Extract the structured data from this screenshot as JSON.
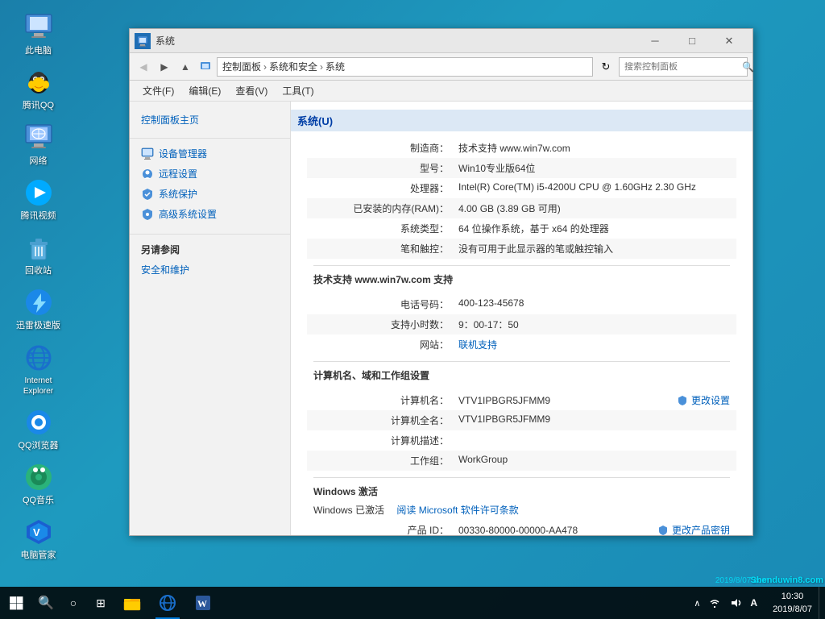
{
  "desktop": {
    "background": "#1a8ab5"
  },
  "desktop_icons": [
    {
      "id": "computer",
      "label": "此电脑",
      "icon": "💻"
    },
    {
      "id": "qq",
      "label": "腾讯QQ",
      "icon": "🐧"
    },
    {
      "id": "network",
      "label": "网络",
      "icon": "🌐"
    },
    {
      "id": "qqvideo",
      "label": "腾讯视频",
      "icon": "📺"
    },
    {
      "id": "recycle",
      "label": "回收站",
      "icon": "🗑️"
    },
    {
      "id": "xunlei",
      "label": "迅雷极速版",
      "icon": "⚡"
    },
    {
      "id": "ie",
      "label": "Internet Explorer",
      "icon": "e"
    },
    {
      "id": "qqbrowser",
      "label": "QQ浏览器",
      "icon": "🔵"
    },
    {
      "id": "qqmusic",
      "label": "QQ音乐",
      "icon": "🎵"
    },
    {
      "id": "pcmanager",
      "label": "电脑管家",
      "icon": "🛡️"
    }
  ],
  "window": {
    "title": "系统",
    "icon": "🖥️"
  },
  "address": {
    "path_parts": [
      "控制面板",
      "系统和安全",
      "系统"
    ],
    "search_placeholder": "搜索控制面板"
  },
  "menu": {
    "items": [
      "文件(F)",
      "编辑(E)",
      "查看(V)",
      "工具(T)"
    ]
  },
  "sidebar": {
    "main_link": "控制面板主页",
    "links": [
      {
        "label": "设备管理器",
        "icon": "🖥"
      },
      {
        "label": "远程设置",
        "icon": "🔒"
      },
      {
        "label": "系统保护",
        "icon": "🔒"
      },
      {
        "label": "高级系统设置",
        "icon": "🔒"
      }
    ],
    "see_also_title": "另请参阅",
    "see_also_links": [
      "安全和维护"
    ]
  },
  "system_info": {
    "section1_title": "系统(U)",
    "manufacturer_label": "制造商：",
    "manufacturer_value": "技术支持 www.win7w.com",
    "model_label": "型号：",
    "model_value": "Win10专业版64位",
    "processor_label": "处理器：",
    "processor_value": "Intel(R) Core(TM) i5-4200U CPU @ 1.60GHz   2.30 GHz",
    "ram_label": "已安装的内存(RAM)：",
    "ram_value": "4.00 GB (3.89 GB 可用)",
    "system_type_label": "系统类型：",
    "system_type_value": "64 位操作系统，基于 x64 的处理器",
    "pen_label": "笔和触控：",
    "pen_value": "没有可用于此显示器的笔或触控输入",
    "support_title": "技术支持 www.win7w.com 支持",
    "phone_label": "电话号码：",
    "phone_value": "400-123-45678",
    "hours_label": "支持小时数：",
    "hours_value": "9：00-17：50",
    "website_label": "网站：",
    "website_value": "联机支持",
    "computer_section_title": "计算机名、域和工作组设置",
    "computer_name_label": "计算机名：",
    "computer_name_value": "VTV1IPBGR5JFMM9",
    "change_settings_label": "更改设置",
    "full_name_label": "计算机全名：",
    "full_name_value": "VTV1IPBGR5JFMM9",
    "description_label": "计算机描述：",
    "description_value": "",
    "workgroup_label": "工作组：",
    "workgroup_value": "WorkGroup",
    "windows_section_title": "Windows 激活",
    "activated_text": "Windows 已激活",
    "license_link": "阅读 Microsoft 软件许可条款",
    "product_id_label": "产品 ID：",
    "product_id_value": "00330-80000-00000-AA478",
    "change_key_label": "更改产品密钥"
  },
  "taskbar": {
    "clock_time": "10:30",
    "clock_date": "2019/8/07"
  },
  "watermark": {
    "site": "Shenduwin8.com",
    "date": "2019/8/07 com"
  }
}
